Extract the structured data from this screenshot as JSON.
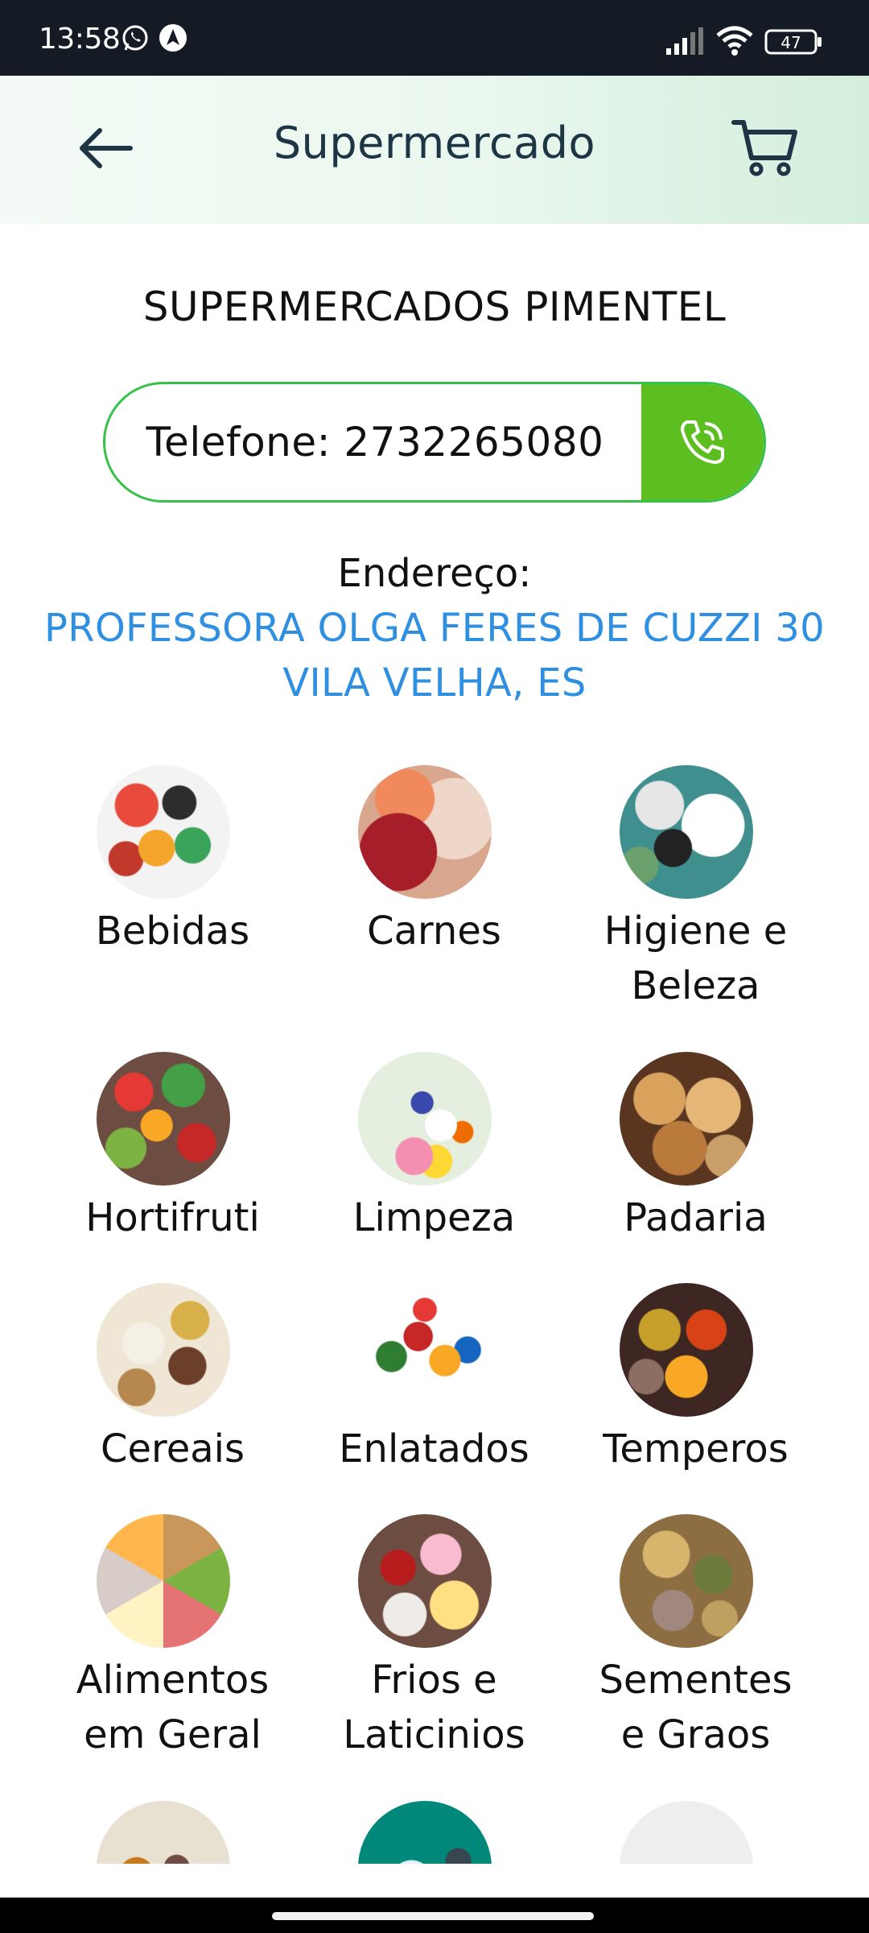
{
  "status_bar": {
    "time": "13:58",
    "battery": "47",
    "icons": [
      "whatsapp-icon",
      "navigation-arrow-icon",
      "signal-icon",
      "wifi-icon",
      "battery-icon"
    ]
  },
  "header": {
    "title": "Supermercado",
    "back_icon": "back-arrow-icon",
    "cart_icon": "shopping-cart-icon",
    "colors": {
      "title": "#1e3545",
      "gradient_start": "#f4fbf6",
      "gradient_end": "#d4eedc"
    }
  },
  "store": {
    "name": "SUPERMERCADOS PIMENTEL",
    "phone_text": "Telefone: 2732265080",
    "call_icon": "phone-call-icon",
    "address_label": "Endereço:",
    "address_line1": "PROFESSORA OLGA FERES DE CUZZI 30",
    "address_line2": "VILA VELHA, ES",
    "colors": {
      "phone_border": "#36c24a",
      "call_button": "#5cbf1f",
      "address": "#2f8fe0"
    }
  },
  "categories": [
    {
      "line1": "Bebidas",
      "line2": ""
    },
    {
      "line1": "Carnes",
      "line2": ""
    },
    {
      "line1": "Higiene e",
      "line2": "Beleza"
    },
    {
      "line1": "Hortifruti",
      "line2": ""
    },
    {
      "line1": "Limpeza",
      "line2": ""
    },
    {
      "line1": "Padaria",
      "line2": ""
    },
    {
      "line1": "Cereais",
      "line2": ""
    },
    {
      "line1": "Enlatados",
      "line2": ""
    },
    {
      "line1": "Temperos",
      "line2": ""
    },
    {
      "line1": "Alimentos",
      "line2": "em Geral"
    },
    {
      "line1": "Frios e",
      "line2": "Laticinios"
    },
    {
      "line1": "Sementes",
      "line2": "e Graos"
    },
    {
      "line1": "",
      "line2": ""
    },
    {
      "line1": "",
      "line2": ""
    },
    {
      "line1": "",
      "line2": ""
    }
  ]
}
